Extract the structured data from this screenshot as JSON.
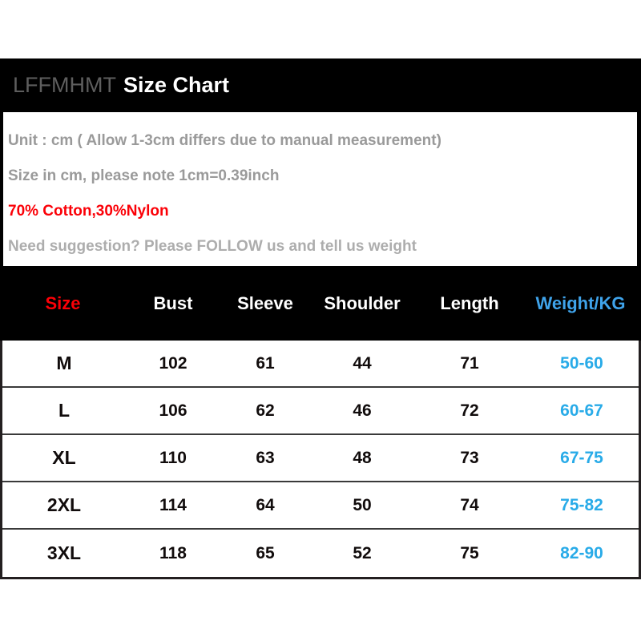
{
  "header": {
    "brand": "LFFMHMT",
    "title": "Size Chart"
  },
  "info": {
    "lines": [
      {
        "text": "Unit : cm ( Allow 1-3cm differs due to manual measurement)",
        "style": "gray"
      },
      {
        "text": "Size in cm, please note 1cm=0.39inch",
        "style": "gray"
      },
      {
        "text": "70% Cotton,30%Nylon",
        "style": "red"
      },
      {
        "text": "Need suggestion? Please FOLLOW us and tell us weight",
        "style": "gray-lt"
      }
    ]
  },
  "colors": {
    "accent_red": "#fb0007",
    "accent_blue": "#29abe8",
    "header_blue": "#3fa3ea",
    "gray_text": "#9a9a9a",
    "gray_text_light": "#adadad",
    "band_black": "#000000"
  },
  "table": {
    "columns": [
      "Size",
      "Bust",
      "Sleeve",
      "Shoulder",
      "Length",
      "Weight/KG"
    ],
    "rows": [
      [
        "M",
        "102",
        "61",
        "44",
        "71",
        "50-60"
      ],
      [
        "L",
        "106",
        "62",
        "46",
        "72",
        "60-67"
      ],
      [
        "XL",
        "110",
        "63",
        "48",
        "73",
        "67-75"
      ],
      [
        "2XL",
        "114",
        "64",
        "50",
        "74",
        "75-82"
      ],
      [
        "3XL",
        "118",
        "65",
        "52",
        "75",
        "82-90"
      ]
    ]
  }
}
